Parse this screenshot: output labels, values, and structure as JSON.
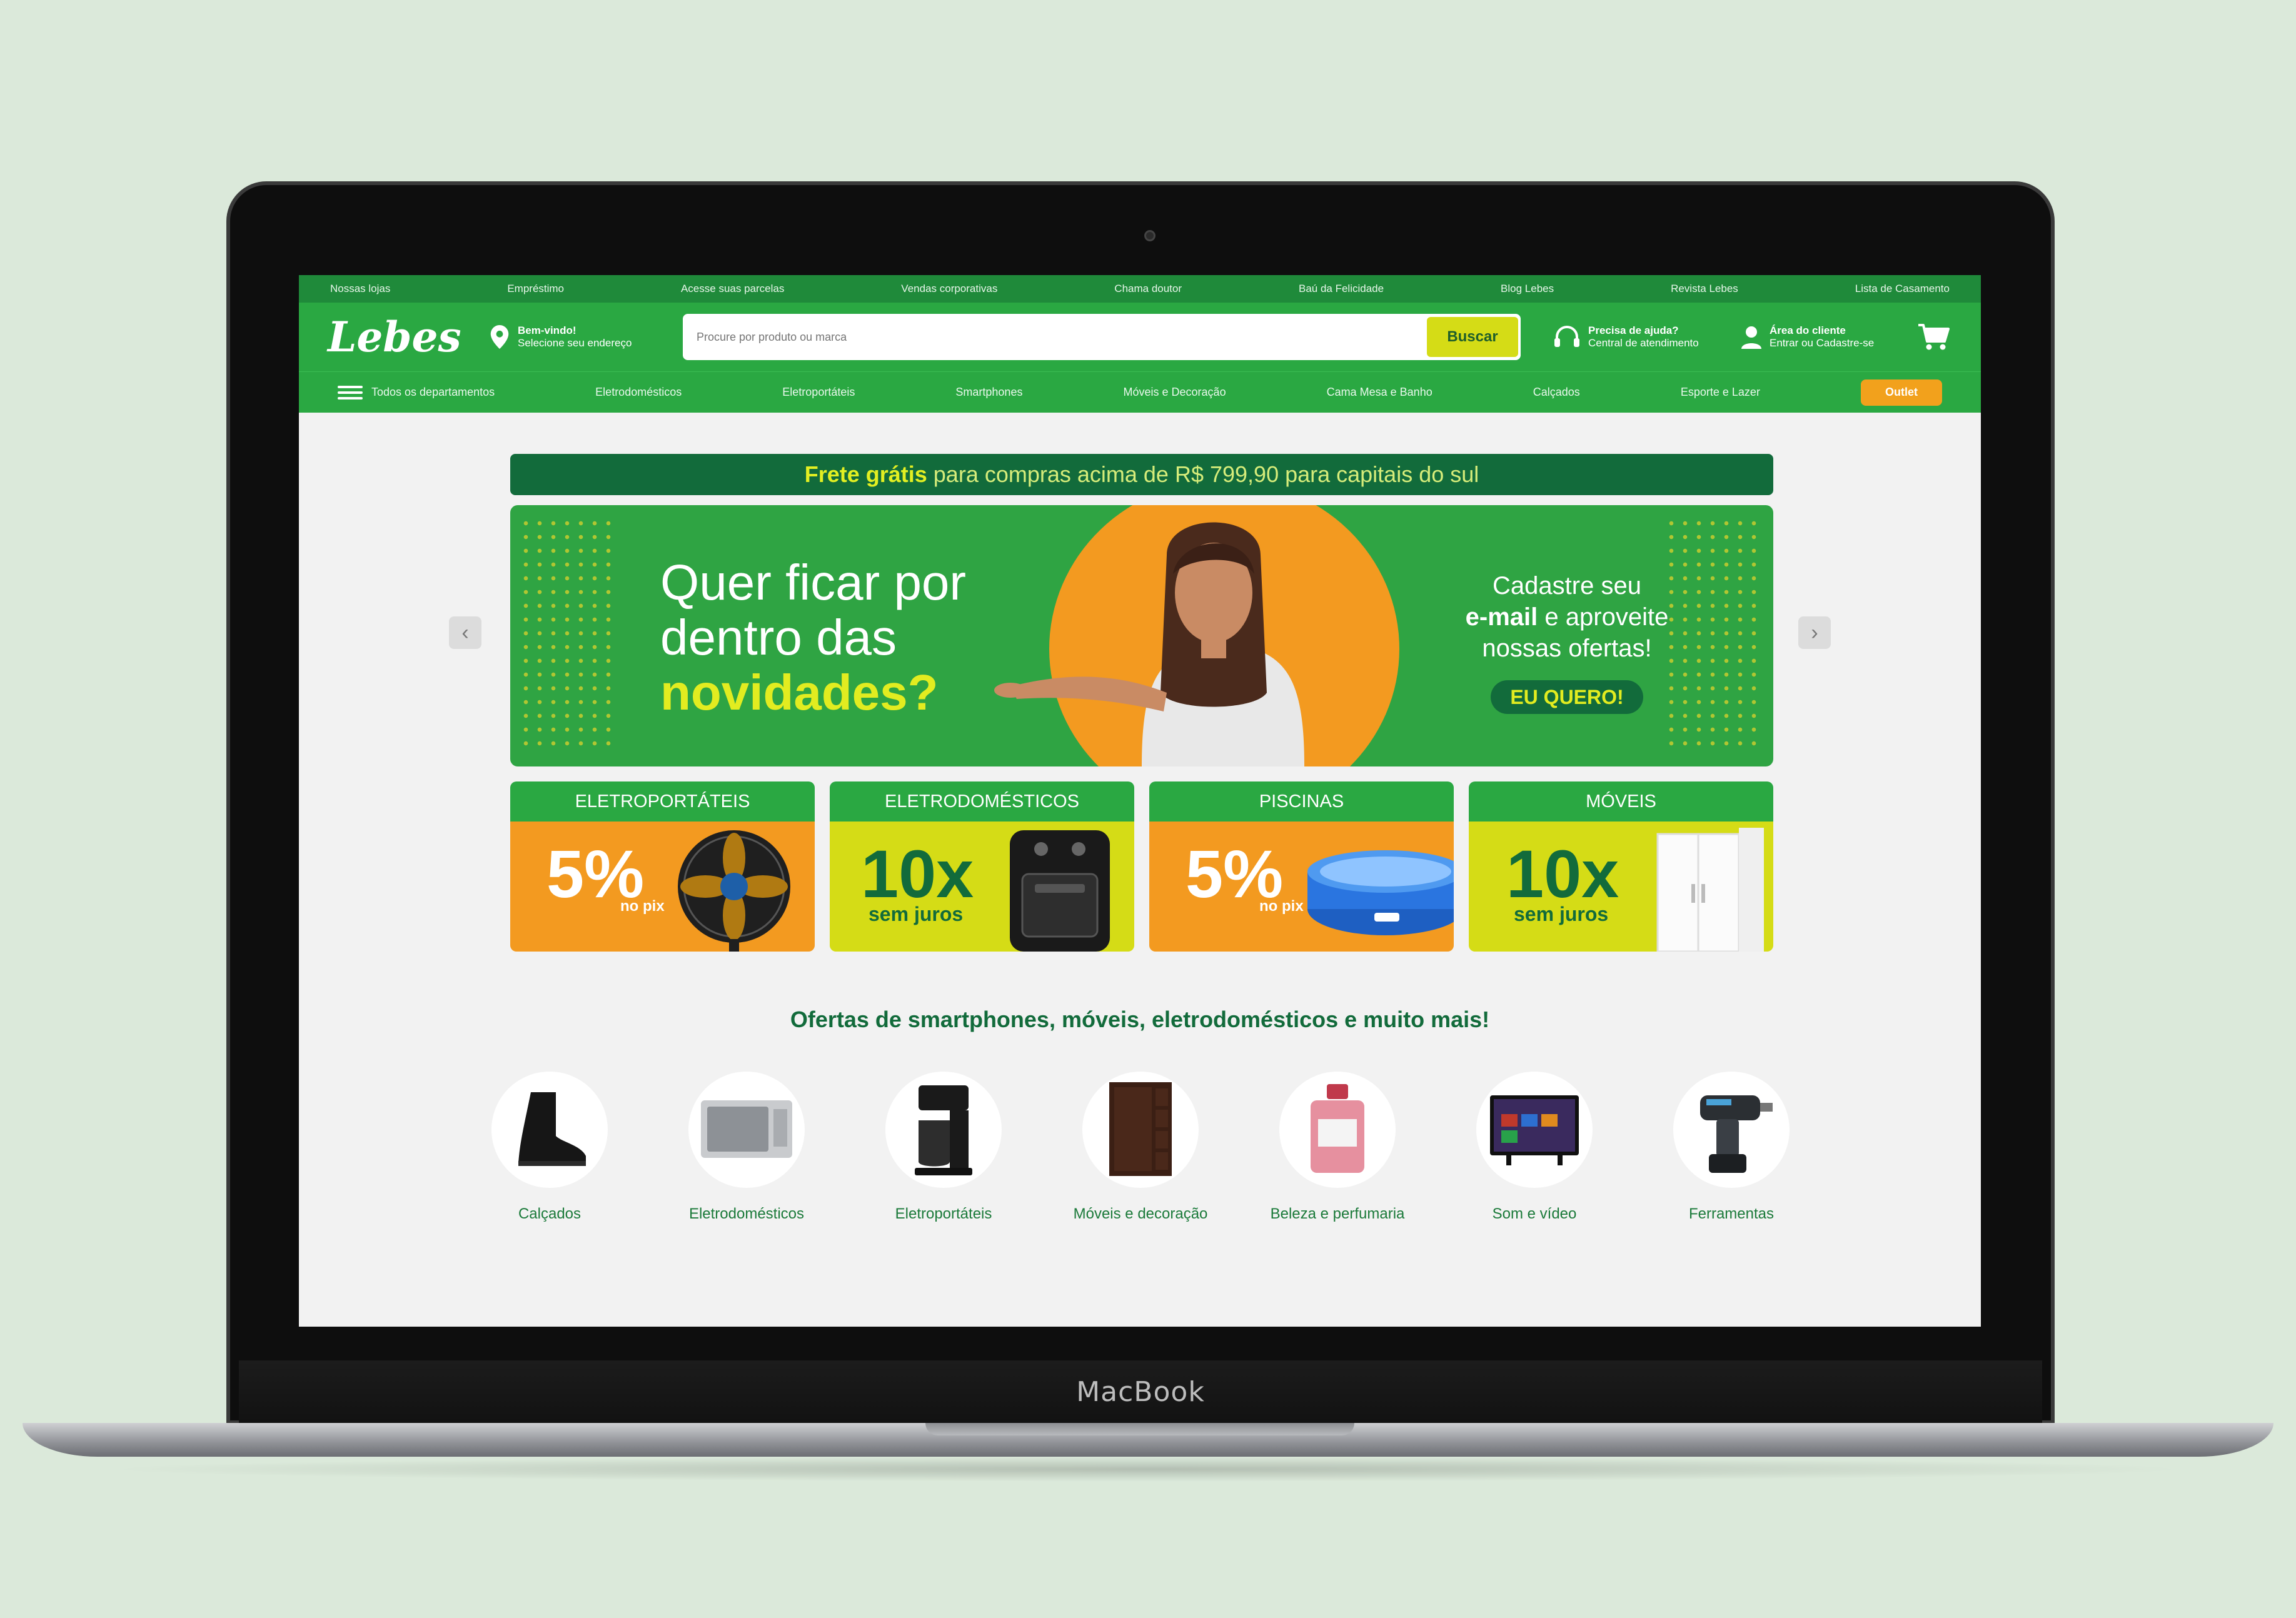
{
  "device": {
    "brand_label": "MacBook"
  },
  "topbar": {
    "links": [
      "Nossas lojas",
      "Empréstimo",
      "Acesse suas parcelas",
      "Vendas corporativas",
      "Chama doutor",
      "Baú da Felicidade",
      "Blog Lebes",
      "Revista Lebes",
      "Lista de Casamento"
    ]
  },
  "header": {
    "logo": "Lebes",
    "location": {
      "title": "Bem-vindo!",
      "subtitle": "Selecione seu endereço"
    },
    "search": {
      "placeholder": "Procure por produto ou marca",
      "button": "Buscar"
    },
    "help": {
      "title": "Precisa de ajuda?",
      "subtitle": "Central de atendimento"
    },
    "account": {
      "title": "Área do cliente",
      "subtitle": "Entrar ou Cadastre-se"
    }
  },
  "catnav": {
    "all": "Todos os departamentos",
    "items": [
      "Eletrodomésticos",
      "Eletroportáteis",
      "Smartphones",
      "Móveis e Decoração",
      "Cama Mesa e Banho",
      "Calçados",
      "Esporte e Lazer"
    ],
    "outlet": "Outlet"
  },
  "shipping": {
    "bold": "Frete grátis",
    "rest": "para compras acima de R$ 799,90 para capitais do sul"
  },
  "hero": {
    "line1": "Quer ficar por",
    "line2": "dentro das",
    "highlight": "novidades?",
    "right1": "Cadastre seu",
    "right_bold": "e-mail",
    "right2": "e aproveite",
    "right3": "nossas ofertas!",
    "cta": "EU QUERO!"
  },
  "promos": [
    {
      "title": "ELETROPORTÁTEIS",
      "big": "5%",
      "sub": "no pix"
    },
    {
      "title": "ELETRODOMÉSTICOS",
      "big": "10x",
      "sub": "sem juros"
    },
    {
      "title": "PISCINAS",
      "big": "5%",
      "sub": "no pix"
    },
    {
      "title": "MÓVEIS",
      "big": "10x",
      "sub": "sem juros"
    }
  ],
  "offers_title": "Ofertas de smartphones, móveis, eletrodomésticos e muito mais!",
  "categories": [
    "Calçados",
    "Eletrodomésticos",
    "Eletroportáteis",
    "Móveis e decoração",
    "Beleza e perfumaria",
    "Som e vídeo",
    "Ferramentas"
  ],
  "colors": {
    "primary_green": "#2aa842",
    "dark_green": "#126b3b",
    "yellow": "#d5dc16",
    "orange": "#f39a20"
  }
}
